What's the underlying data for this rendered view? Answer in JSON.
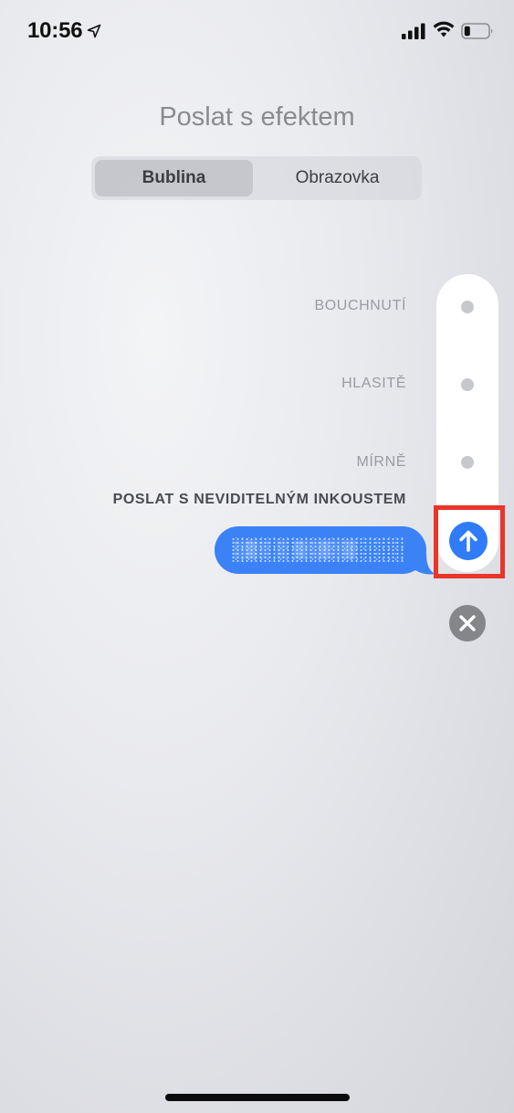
{
  "status_bar": {
    "time": "10:56",
    "icons": [
      "location-arrow-icon",
      "cellular-signal-icon",
      "wifi-icon",
      "battery-icon"
    ]
  },
  "title": "Poslat s efektem",
  "segmented_control": {
    "selected": "Bublina",
    "options": [
      "Bublina",
      "Obrazovka"
    ]
  },
  "effects": [
    {
      "label": "BOUCHNUTÍ"
    },
    {
      "label": "HLASITĚ"
    },
    {
      "label": "MÍRNĚ"
    }
  ],
  "selected_effect_label": "POSLAT S NEVIDITELNÝM INKOUSTEM",
  "message_bubble": {
    "text": "░▒░ ░ ▒░▒░▒"
  },
  "colors": {
    "accent_blue": "#2f7cf6",
    "bubble_blue": "#3a82f6",
    "highlight_red": "#e8362a",
    "close_gray": "#85868a"
  }
}
